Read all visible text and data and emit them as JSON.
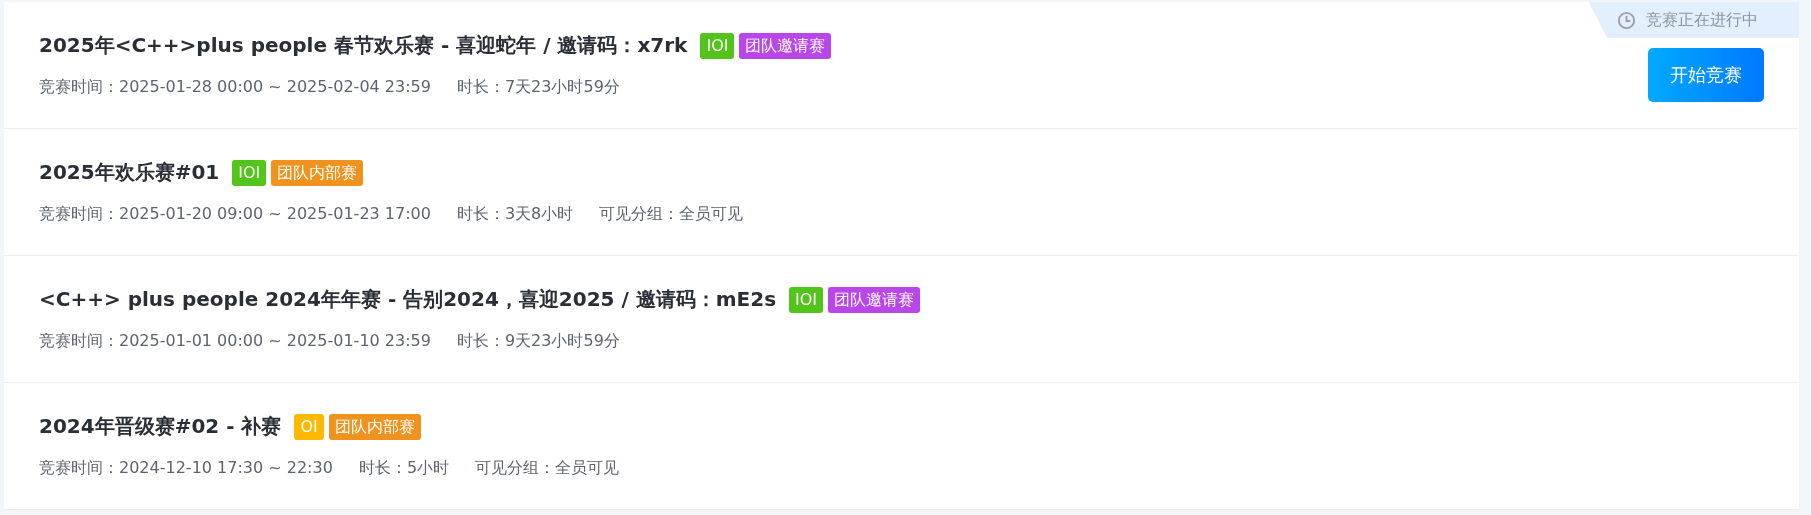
{
  "contests": [
    {
      "title": "2025年<C++>plus people 春节欢乐赛 - 喜迎蛇年 / 邀请码：x7rk",
      "tags": [
        {
          "label": "IOI",
          "color": "#52c41a"
        },
        {
          "label": "团队邀请赛",
          "color": "#b846e8"
        }
      ],
      "meta": [
        "竞赛时间：2025-01-28 00:00 ~ 2025-02-04 23:59",
        "时长：7天23小时59分"
      ],
      "status": "竞赛正在进行中",
      "action": "开始竞赛"
    },
    {
      "title": "2025年欢乐赛#01",
      "tags": [
        {
          "label": "IOI",
          "color": "#52c41a"
        },
        {
          "label": "团队内部赛",
          "color": "#f0931e"
        }
      ],
      "meta": [
        "竞赛时间：2025-01-20 09:00 ~ 2025-01-23 17:00",
        "时长：3天8小时",
        "可见分组：全员可见"
      ]
    },
    {
      "title": "<C++> plus people 2024年年赛 - 告别2024，喜迎2025 / 邀请码：mE2s",
      "tags": [
        {
          "label": "IOI",
          "color": "#52c41a"
        },
        {
          "label": "团队邀请赛",
          "color": "#b846e8"
        }
      ],
      "meta": [
        "竞赛时间：2025-01-01 00:00 ~ 2025-01-10 23:59",
        "时长：9天23小时59分"
      ]
    },
    {
      "title": "2024年晋级赛#02 - 补赛",
      "tags": [
        {
          "label": "OI",
          "color": "#fcb900"
        },
        {
          "label": "团队内部赛",
          "color": "#f0931e"
        }
      ],
      "meta": [
        "竞赛时间：2024-12-10 17:30 ~ 22:30",
        "时长：5小时",
        "可见分组：全员可见"
      ]
    }
  ]
}
